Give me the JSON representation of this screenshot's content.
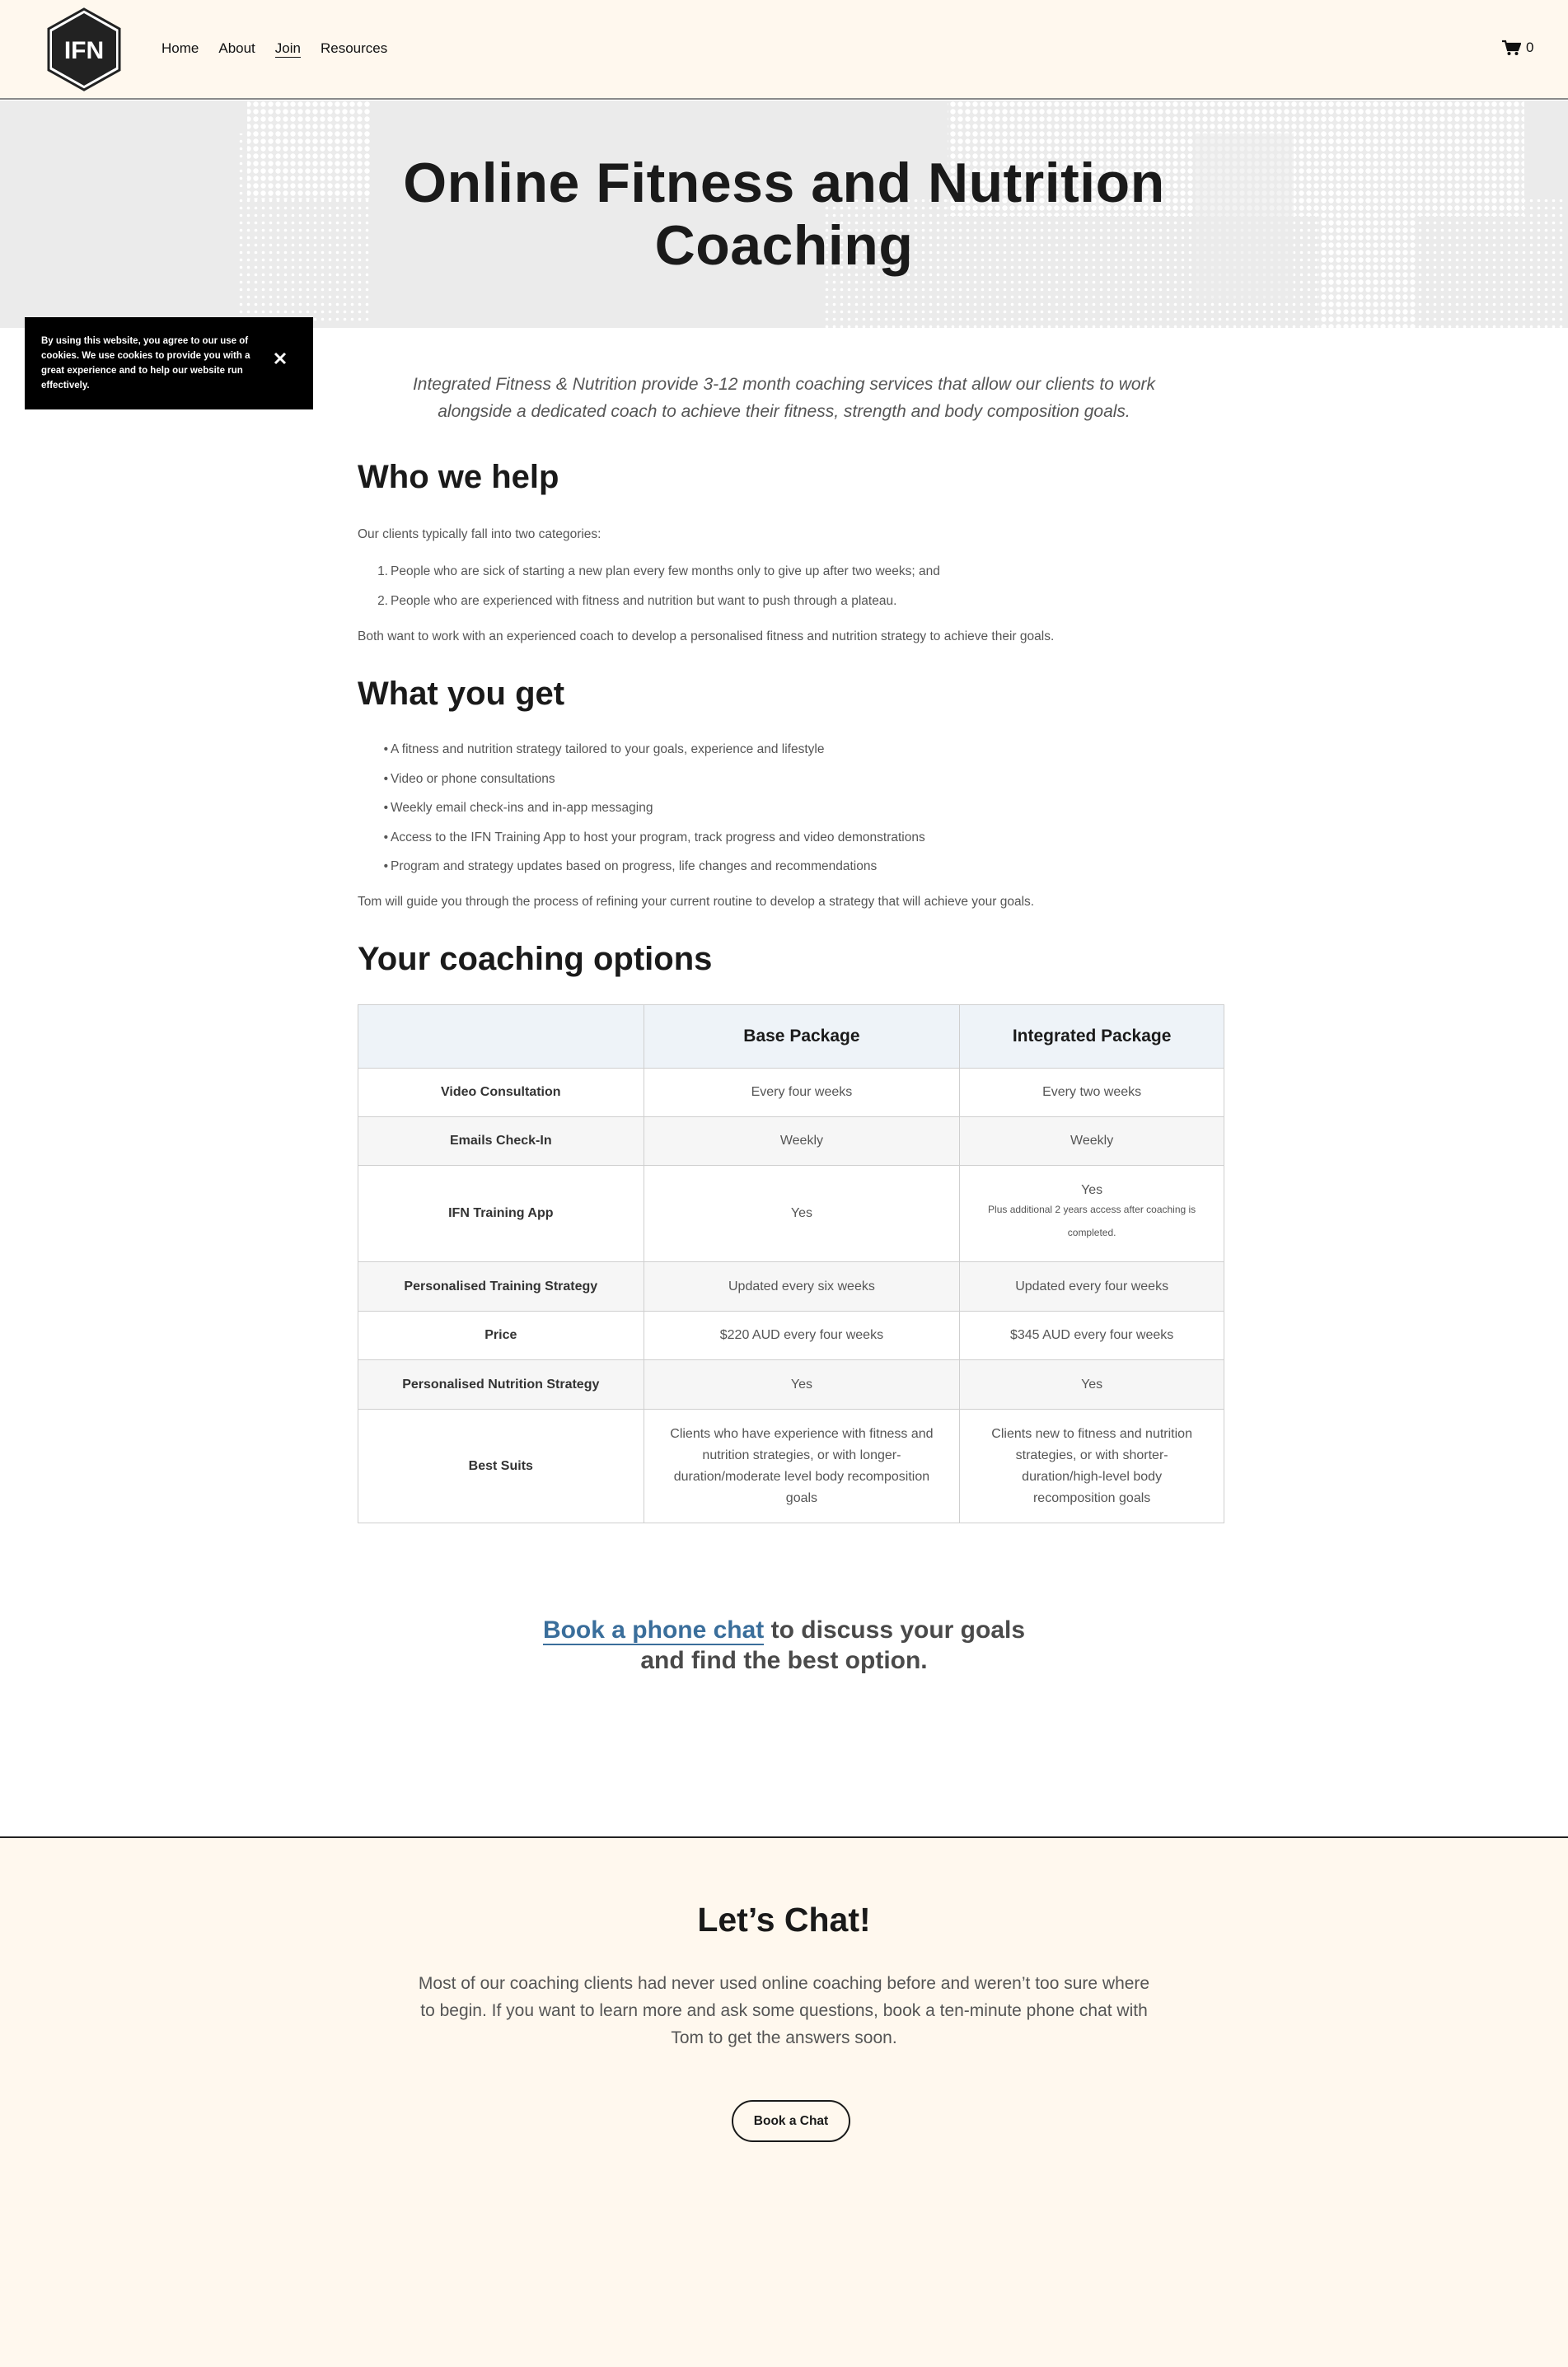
{
  "header": {
    "logo_text": "IFN",
    "nav": [
      "Home",
      "About",
      "Join",
      "Resources"
    ],
    "active_nav": "Join",
    "cart_count": "0"
  },
  "hero": {
    "title_line1": "Online Fitness and Nutrition",
    "title_line2": "Coaching"
  },
  "cookie_banner": {
    "text": "By using this website, you agree to our use of cookies. We use cookies to provide you with a great experience and to help our website run effectively.",
    "close_icon": "close-icon"
  },
  "intro": "Integrated Fitness & Nutrition provide 3-12 month coaching services that allow our clients to work alongside a dedicated coach to achieve their fitness, strength and body composition goals.",
  "who_we_help": {
    "heading": "Who we help",
    "lead": "Our clients typically fall into two categories:",
    "items": [
      "People who are sick of starting a new plan every few months only to give up after two weeks; and",
      "People who are experienced with fitness and nutrition but want to push through a plateau."
    ],
    "closing": "Both want to work with an experienced coach to develop a personalised fitness and nutrition strategy to achieve their goals."
  },
  "what_you_get": {
    "heading": "What you get",
    "items": [
      "A fitness and nutrition strategy tailored to your goals, experience and lifestyle",
      "Video or phone consultations",
      "Weekly email check-ins and in-app messaging",
      "Access to the IFN Training App to host your program, track progress and video demonstrations",
      "Program and strategy updates based on progress, life changes and recommendations"
    ],
    "closing": "Tom will guide you through the process of refining your current routine to develop a strategy that will achieve your goals."
  },
  "coaching_options": {
    "heading": "Your coaching options",
    "columns": [
      "",
      "Base Package",
      "Integrated Package"
    ],
    "rows": [
      {
        "label": "Video Consultation",
        "base": "Every four weeks",
        "integrated": "Every two weeks"
      },
      {
        "label": "Emails Check-In",
        "base": "Weekly",
        "integrated": "Weekly"
      },
      {
        "label": "IFN Training App",
        "base": "Yes",
        "integrated": "Yes",
        "integrated_note": "Plus additional 2 years access after coaching is completed."
      },
      {
        "label": "Personalised Training Strategy",
        "base": "Updated every six weeks",
        "integrated": "Updated every four weeks"
      },
      {
        "label": "Price",
        "base": "$220 AUD every four weeks",
        "integrated": "$345 AUD every four weeks"
      },
      {
        "label": "Personalised Nutrition Strategy",
        "base": "Yes",
        "integrated": "Yes"
      },
      {
        "label": "Best Suits",
        "base": "Clients who have experience with fitness and nutrition strategies, or with longer-duration/moderate level body recomposition goals",
        "integrated": "Clients new to fitness and nutrition strategies, or with shorter-duration/high-level body recomposition goals"
      }
    ]
  },
  "cta": {
    "link_text": "Book a phone chat",
    "rest_line1": " to discuss your goals",
    "line2": "and find the best option.",
    "link_color": "#3a6e9b"
  },
  "footer": {
    "title": "Let’s Chat!",
    "text": "Most of our coaching clients had never used online coaching before and weren’t too sure where to begin. If you want to learn more and ask some questions, book a ten-minute phone chat with Tom to get the answers soon.",
    "button": "Book a Chat"
  },
  "colors": {
    "header_bg": "#fff8ee",
    "hero_bg": "#ebebeb",
    "table_header_bg": "#eef3f8",
    "link": "#3a6e9b"
  }
}
